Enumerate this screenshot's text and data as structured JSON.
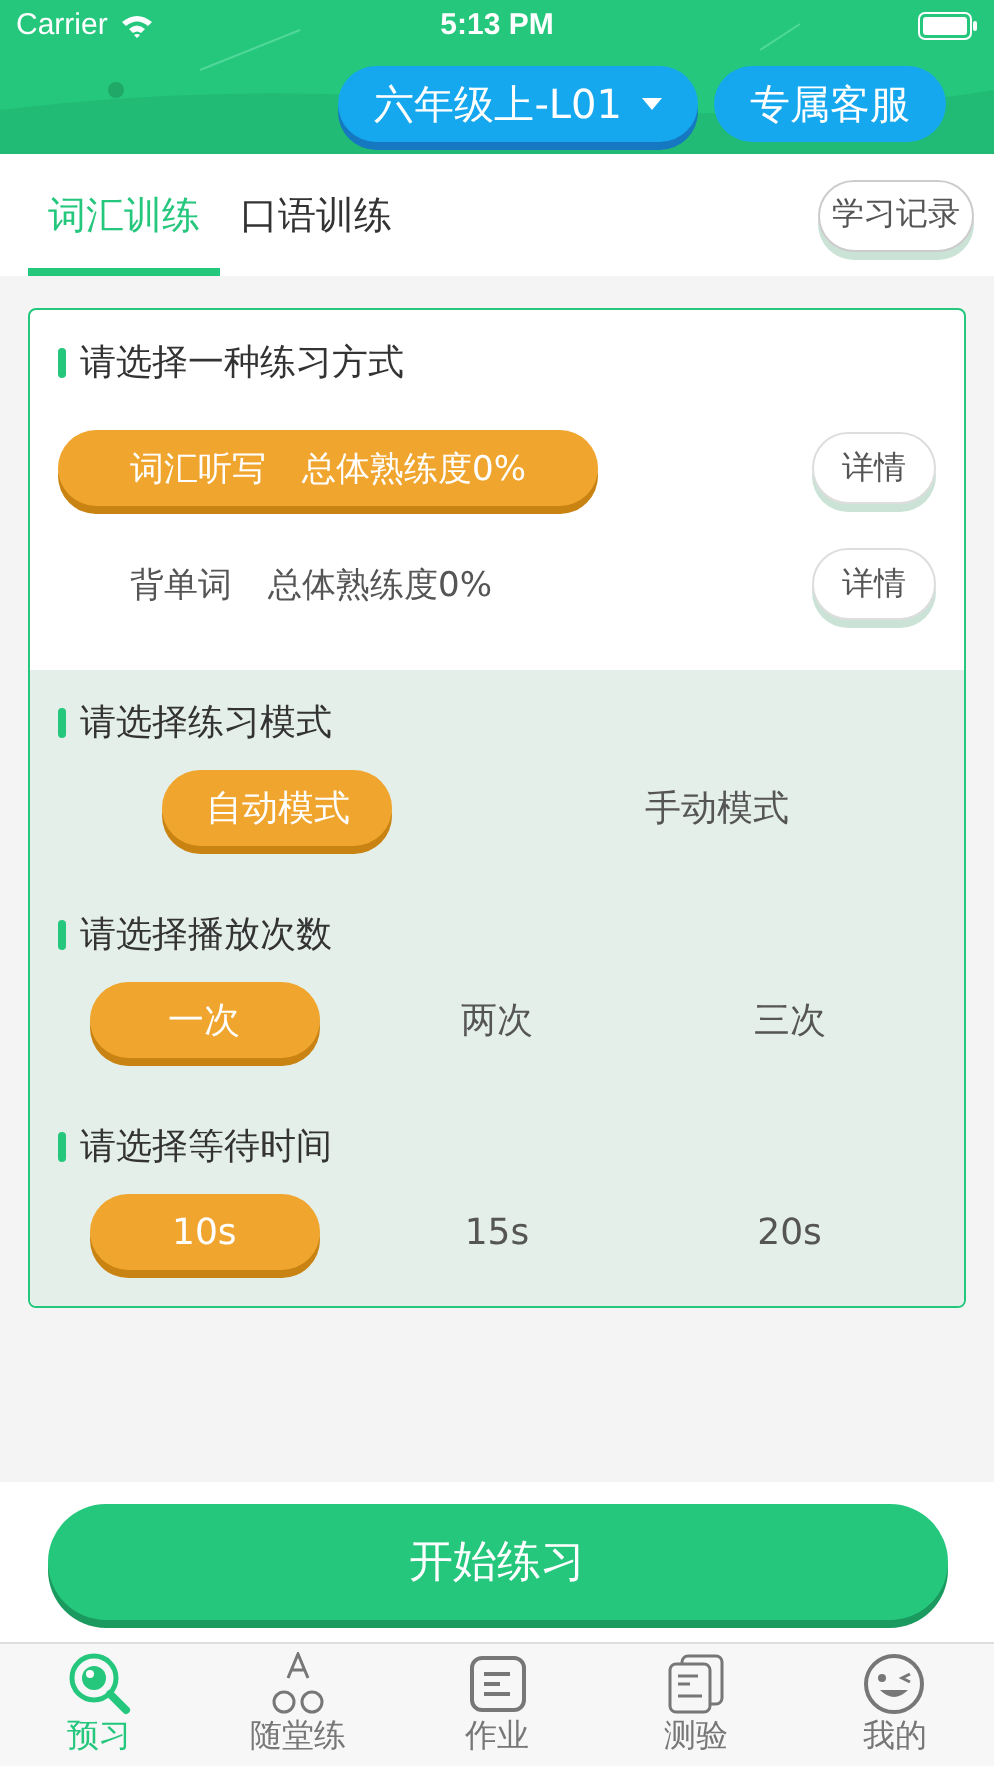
{
  "status_bar": {
    "carrier": "Carrier",
    "time": "5:13 PM"
  },
  "header": {
    "grade": "六年级上-L01",
    "service": "专属客服"
  },
  "tabs": [
    {
      "label": "词汇训练",
      "selected": true
    },
    {
      "label": "口语训练",
      "selected": false
    }
  ],
  "history_button": "学习记录",
  "sections": [
    {
      "title": "请选择一种练习方式",
      "kind": "methods",
      "options": [
        {
          "label": "词汇听写",
          "progress": "总体熟练度0%",
          "selected": true,
          "detail": "详情"
        },
        {
          "label": "背单词",
          "progress": "总体熟练度0%",
          "selected": false,
          "detail": "详情"
        }
      ]
    },
    {
      "title": "请选择练习模式",
      "kind": "choices",
      "options": [
        {
          "label": "自动模式",
          "selected": true
        },
        {
          "label": "手动模式",
          "selected": false
        }
      ]
    },
    {
      "title": "请选择播放次数",
      "kind": "choices",
      "options": [
        {
          "label": "一次",
          "selected": true
        },
        {
          "label": "两次",
          "selected": false
        },
        {
          "label": "三次",
          "selected": false
        }
      ]
    },
    {
      "title": "请选择等待时间",
      "kind": "choices",
      "options": [
        {
          "label": "10s",
          "selected": true
        },
        {
          "label": "15s",
          "selected": false
        },
        {
          "label": "20s",
          "selected": false
        }
      ]
    }
  ],
  "start_button": "开始练习",
  "nav": [
    {
      "label": "预习",
      "kind": "search",
      "selected": true
    },
    {
      "label": "随堂练",
      "kind": "letters",
      "selected": false
    },
    {
      "label": "作业",
      "kind": "doc",
      "selected": false
    },
    {
      "label": "测验",
      "kind": "stack",
      "selected": false
    },
    {
      "label": "我的",
      "kind": "face",
      "selected": false
    }
  ]
}
